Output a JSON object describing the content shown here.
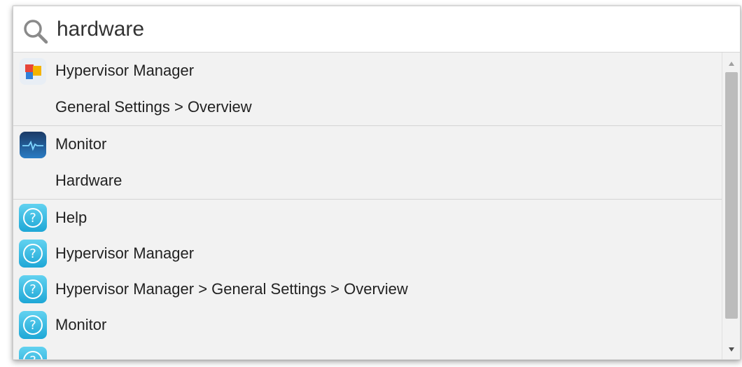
{
  "search": {
    "query": "hardware"
  },
  "groups": [
    {
      "app": "Hypervisor Manager",
      "icon": "hypervisor-manager-icon",
      "items": [
        "General Settings > Overview"
      ]
    },
    {
      "app": "Monitor",
      "icon": "monitor-icon",
      "items": [
        "Hardware"
      ]
    },
    {
      "help_items": [
        "Help",
        "Hypervisor Manager",
        "Hypervisor Manager > General Settings > Overview",
        "Monitor"
      ],
      "icon": "help-icon"
    }
  ],
  "colors": {
    "panel_bg": "#f2f2f2",
    "help_icon": "#1ea7d6",
    "monitor_icon": "#1c4f8c",
    "scroll_thumb": "#bcbcbc"
  }
}
